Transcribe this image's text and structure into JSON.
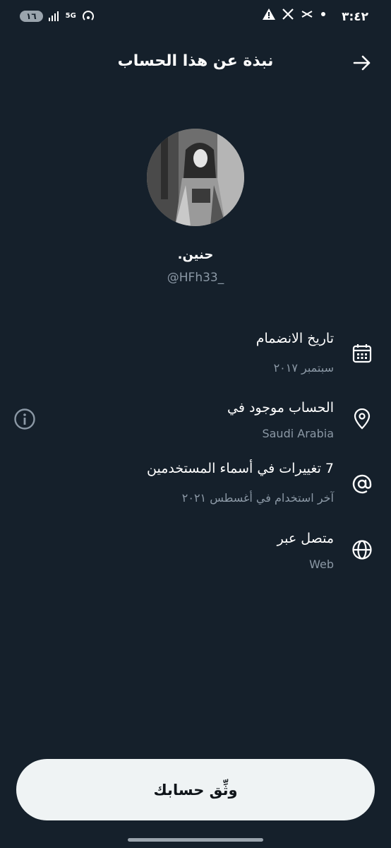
{
  "status_bar": {
    "time": "٣:٤٢",
    "battery": "١٦",
    "network": "5G"
  },
  "header": {
    "title": "نبذة عن هذا الحساب"
  },
  "profile": {
    "display_name": "حنين.",
    "handle": "@HFh33_"
  },
  "info_rows": [
    {
      "title": "تاريخ الانضمام",
      "subtitle": "سبتمبر ٢٠١٧",
      "icon": "calendar-icon"
    },
    {
      "title": "الحساب موجود في",
      "subtitle": "Saudi Arabia",
      "icon": "location-pin-icon"
    },
    {
      "title": "7 تغييرات في أسماء المستخدمين",
      "subtitle": "آخر استخدام في أغسطس ٢٠٢١",
      "icon": "at-sign-icon"
    },
    {
      "title": "متصل عبر",
      "subtitle": "Web",
      "icon": "globe-icon"
    }
  ],
  "verify_button": {
    "label": "وثِّق حسابك"
  },
  "colors": {
    "background": "#15202b",
    "primary_text": "#e7e9ea",
    "secondary_text": "#8b98a5",
    "button_bg": "#eff3f4"
  }
}
